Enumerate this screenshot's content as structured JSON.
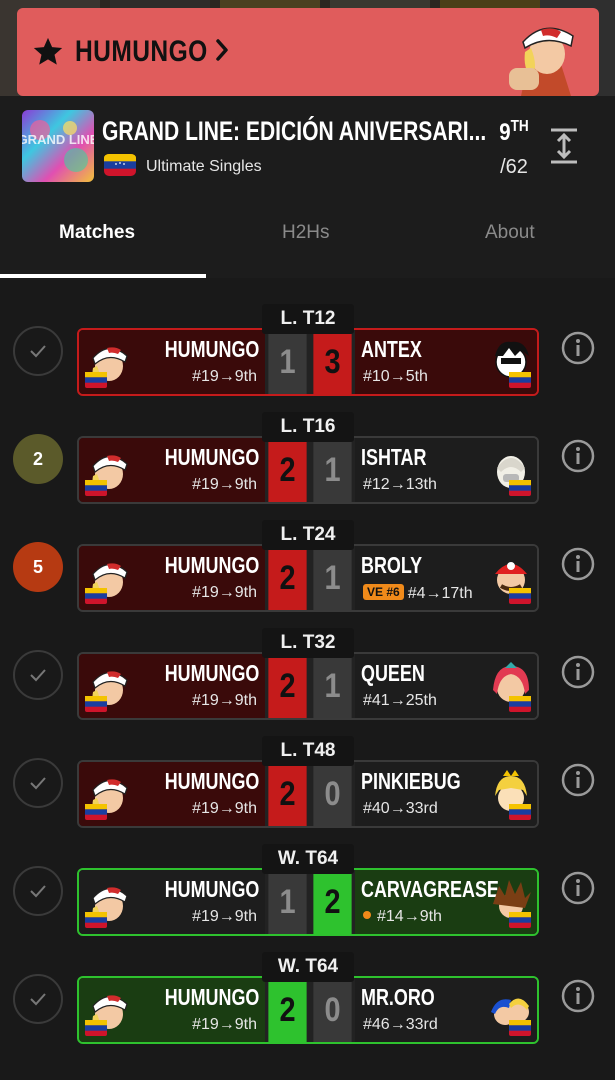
{
  "banner": {
    "player_name": "HUMUNGO"
  },
  "tournament": {
    "title": "GRAND LINE: EDICIÓN ANIVERSARI...",
    "event": "Ultimate Singles",
    "placement": "9",
    "placement_suffix": "TH",
    "entrants": "/62",
    "logo_text": "GRAND LINE"
  },
  "tabs": [
    {
      "label": "Matches",
      "active": true
    },
    {
      "label": "H2Hs",
      "active": false
    },
    {
      "label": "About",
      "active": false
    }
  ],
  "colors": {
    "banner": "#e05c5c",
    "loss": "#c51b1b",
    "win": "#2ec22e",
    "badge": "#f08a1a"
  },
  "matches": [
    {
      "round": "L. T12",
      "status": "check",
      "status_text": "",
      "player": "HUMUNGO",
      "player_seed": "#19→9th",
      "player_score": "1",
      "opponent": "ANTEX",
      "opponent_seed": "#10→5th",
      "opponent_score": "3",
      "result": "loss",
      "card_border": "#c51b1b",
      "opp_badge": "",
      "opp_dot": false
    },
    {
      "round": "L. T16",
      "status": "number",
      "status_text": "2",
      "status_color": "#5b5a2a",
      "player": "HUMUNGO",
      "player_seed": "#19→9th",
      "player_score": "2",
      "opponent": "ISHTAR",
      "opponent_seed": "#12→13th",
      "opponent_score": "1",
      "result": "win",
      "card_border": "#3a3a3a",
      "opp_badge": "",
      "opp_dot": false
    },
    {
      "round": "L. T24",
      "status": "number",
      "status_text": "5",
      "status_color": "#b63a12",
      "player": "HUMUNGO",
      "player_seed": "#19→9th",
      "player_score": "2",
      "opponent": "BROLY",
      "opponent_seed": "#4→17th",
      "opponent_score": "1",
      "result": "win",
      "card_border": "#3a3a3a",
      "opp_badge": "VE #6",
      "opp_dot": false
    },
    {
      "round": "L. T32",
      "status": "check",
      "status_text": "",
      "player": "HUMUNGO",
      "player_seed": "#19→9th",
      "player_score": "2",
      "opponent": "QUEEN",
      "opponent_seed": "#41→25th",
      "opponent_score": "1",
      "result": "win",
      "card_border": "#3a3a3a",
      "opp_badge": "",
      "opp_dot": false
    },
    {
      "round": "L. T48",
      "status": "check",
      "status_text": "",
      "player": "HUMUNGO",
      "player_seed": "#19→9th",
      "player_score": "2",
      "opponent": "PINKIEBUG",
      "opponent_seed": "#40→33rd",
      "opponent_score": "0",
      "result": "win",
      "card_border": "#3a3a3a",
      "opp_badge": "",
      "opp_dot": false
    },
    {
      "round": "W. T64",
      "status": "check",
      "status_text": "",
      "player": "HUMUNGO",
      "player_seed": "#19→9th",
      "player_score": "1",
      "opponent": "CARVAGREASE",
      "opponent_seed": "#14→9th",
      "opponent_score": "2",
      "result": "opp-win",
      "card_border": "#2ec22e",
      "opp_badge": "",
      "opp_dot": true
    },
    {
      "round": "W. T64",
      "status": "check",
      "status_text": "",
      "player": "HUMUNGO",
      "player_seed": "#19→9th",
      "player_score": "2",
      "opponent": "MR.ORO",
      "opponent_seed": "#46→33rd",
      "opponent_score": "0",
      "result": "green-win",
      "card_border": "#2ec22e",
      "opp_badge": "",
      "opp_dot": false
    }
  ]
}
